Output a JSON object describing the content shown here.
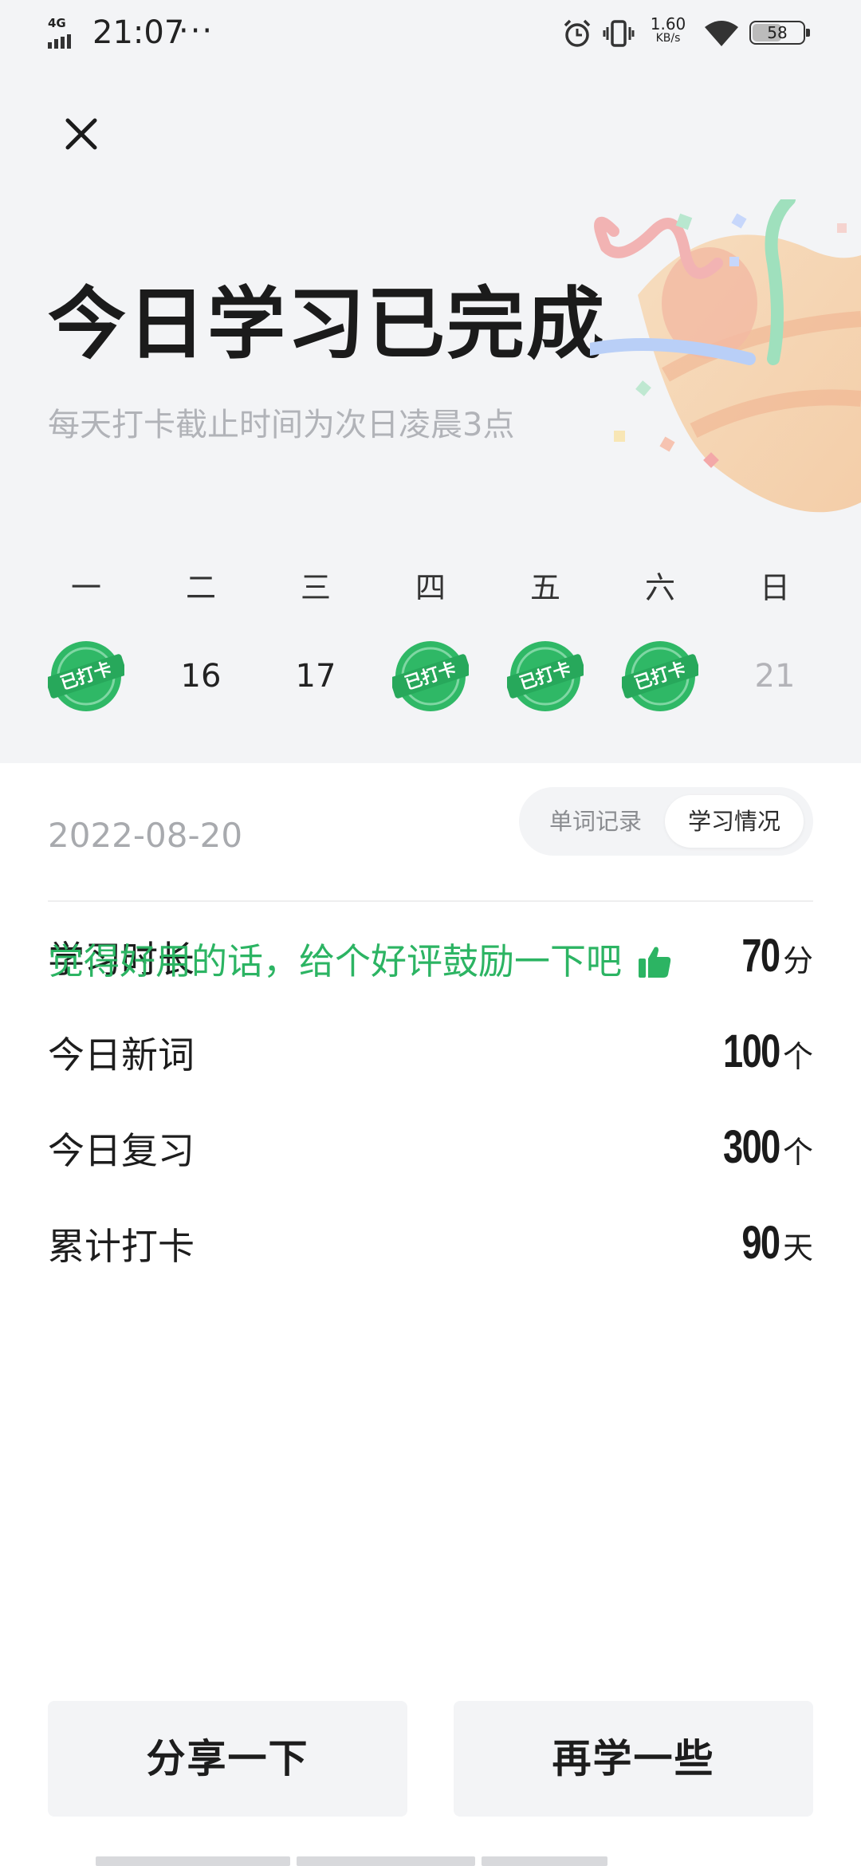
{
  "status_bar": {
    "network": "4G",
    "time": "21:07",
    "more": "···",
    "speed_value": "1.60",
    "speed_unit": "KB/s",
    "battery": "58",
    "battery_level": 0.58
  },
  "header": {
    "title": "今日学习已完成",
    "subtitle": "每天打卡截止时间为次日凌晨3点"
  },
  "week": {
    "days": [
      {
        "label": "一",
        "date": "",
        "checked": true
      },
      {
        "label": "二",
        "date": "16",
        "checked": false
      },
      {
        "label": "三",
        "date": "17",
        "checked": false
      },
      {
        "label": "四",
        "date": "",
        "checked": true
      },
      {
        "label": "五",
        "date": "",
        "checked": true
      },
      {
        "label": "六",
        "date": "",
        "checked": true
      },
      {
        "label": "日",
        "date": "21",
        "checked": false,
        "future": true
      }
    ],
    "stamp_text": "已打卡",
    "stamp_color": "#2fb866"
  },
  "record": {
    "date": "2022-08-20",
    "tabs": [
      "单词记录",
      "学习情况"
    ],
    "active_tab": "学习情况"
  },
  "stats": [
    {
      "label": "学习时长",
      "value": "70",
      "unit": "分"
    },
    {
      "label": "今日新词",
      "value": "100",
      "unit": "个"
    },
    {
      "label": "今日复习",
      "value": "300",
      "unit": "个"
    },
    {
      "label": "累计打卡",
      "value": "90",
      "unit": "天"
    }
  ],
  "praise": {
    "text": "觉得好用的话，给个好评鼓励一下吧",
    "icon": "thumbs-up-icon",
    "color": "#2cb463"
  },
  "actions": {
    "share_label": "分享一下",
    "more_label": "再学一些"
  }
}
